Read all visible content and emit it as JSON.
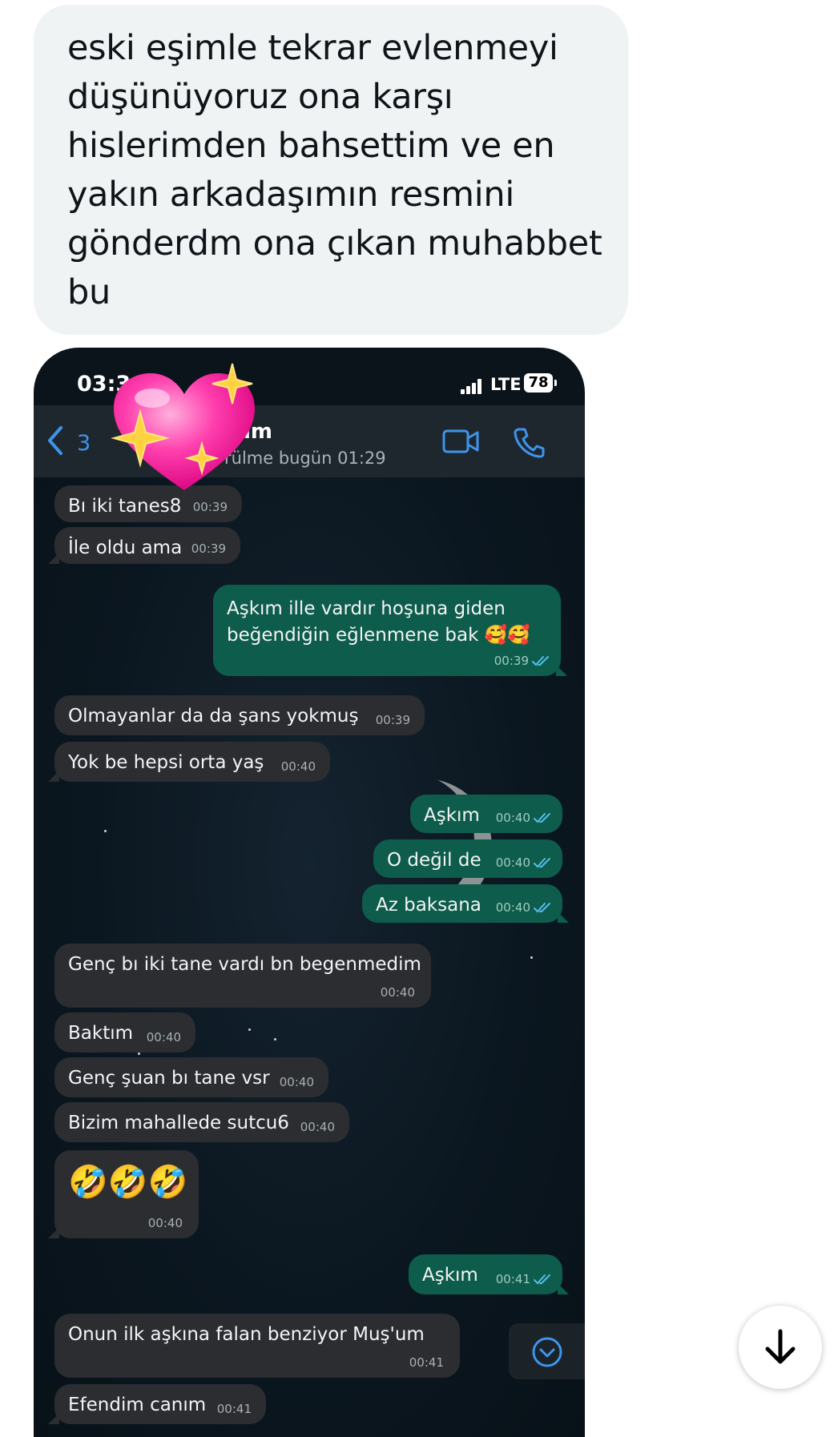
{
  "tweet": {
    "text": "eski eşimle tekrar evlenmeyi\ndüşünüyoruz ona karşı\nhislerimden bahsettim ve en\nyakın arkadaşımın resmini\ngönderdm ona çıkan muhabbet\nbu"
  },
  "screenshot": {
    "status_bar": {
      "time": "03:3",
      "network": "LTE",
      "battery": "78"
    },
    "header": {
      "back_count": "3",
      "contact_name": "ım",
      "last_seen": "rülme bugün 01:29",
      "icons": [
        "back-chevron-icon",
        "video-call-icon",
        "phone-call-icon"
      ]
    },
    "sticker": "sparkling-heart",
    "messages": [
      {
        "dir": "in",
        "text": "Bı iki tanes8",
        "time": "00:39"
      },
      {
        "dir": "in",
        "text": "İle oldu ama",
        "time": "00:39"
      },
      {
        "dir": "out",
        "text": "Aşkım ille vardır hoşuna giden\nbeğendiğin eğlenmene bak 🥰🥰",
        "time": "00:39",
        "read": true
      },
      {
        "dir": "in",
        "text": "Olmayanlar da da şans yokmuş",
        "time": "00:39"
      },
      {
        "dir": "in",
        "text": "Yok be hepsi orta yaş",
        "time": "00:40"
      },
      {
        "dir": "out",
        "text": "Aşkım",
        "time": "00:40",
        "read": true
      },
      {
        "dir": "out",
        "text": "O değil de",
        "time": "00:40",
        "read": true
      },
      {
        "dir": "out",
        "text": "Az baksana",
        "time": "00:40",
        "read": true
      },
      {
        "dir": "in",
        "text": "Genç bı iki tane vardı bn begenmedim",
        "time": "00:40"
      },
      {
        "dir": "in",
        "text": "Baktım",
        "time": "00:40"
      },
      {
        "dir": "in",
        "text": "Genç şuan bı tane vsr",
        "time": "00:40"
      },
      {
        "dir": "in",
        "text": "Bizim mahallede sutcu6",
        "time": "00:40"
      },
      {
        "dir": "in",
        "text": "🤣🤣🤣",
        "time": "00:40"
      },
      {
        "dir": "out",
        "text": "Aşkım",
        "time": "00:41",
        "read": true
      },
      {
        "dir": "in",
        "text": "Onun ilk aşkına falan benziyor Muş'um",
        "time": "00:41"
      },
      {
        "dir": "in",
        "text": "Efendim canım",
        "time": "00:41"
      }
    ],
    "scroll_button_icon": "chevron-down-circle-icon"
  },
  "page_scroll_button_icon": "arrow-down-icon",
  "colors": {
    "incoming_bubble": "#2b2d30",
    "outgoing_bubble": "#0e5c4c",
    "accent_blue": "#3e94ec",
    "tweet_bubble": "#eff3f4"
  }
}
